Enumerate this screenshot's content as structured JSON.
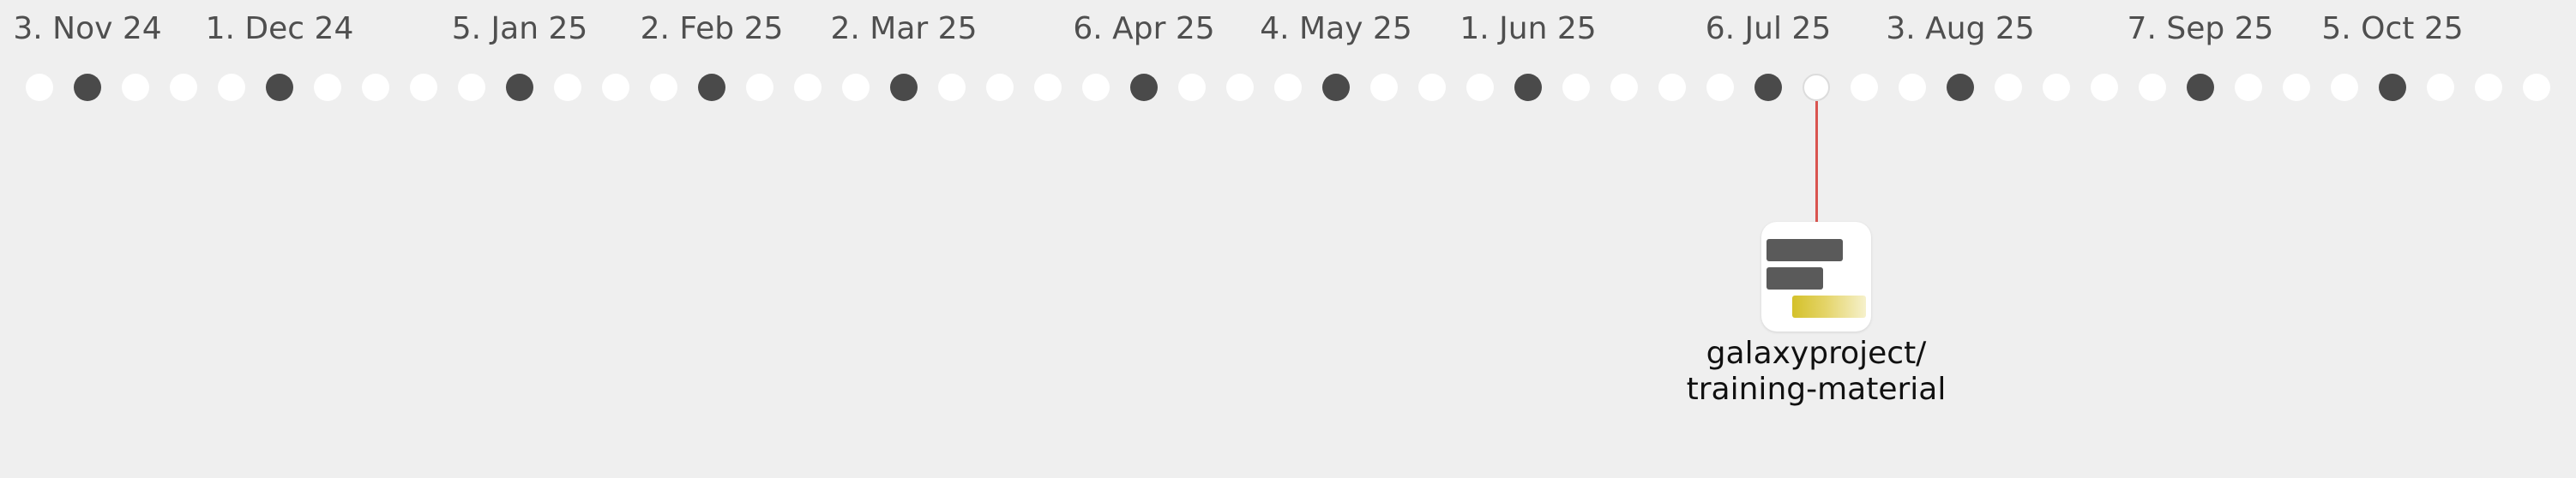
{
  "timeline": {
    "month_labels": [
      "3. Nov 24",
      "1. Dec 24",
      "5. Jan 25",
      "2. Feb 25",
      "2. Mar 25",
      "6. Apr 25",
      "4. May 25",
      "1. Jun 25",
      "6. Jul 25",
      "3. Aug 25",
      "7. Sep 25",
      "5. Oct 25"
    ],
    "dot_count": 53,
    "major_dot_indices": [
      1,
      5,
      10,
      14,
      18,
      23,
      27,
      31,
      36,
      40,
      45,
      49
    ],
    "focused_dot_index": 37,
    "colors": {
      "background": "#efefef",
      "dot": "#ffffff",
      "major_dot": "#4a4a4a",
      "connector": "#d9544f",
      "label": "#4f4f4f"
    }
  },
  "repo": {
    "name_line1": "galaxyproject/",
    "name_line2": "training-material",
    "icon": "repo-bars-icon",
    "accent_color": "#d4c12a"
  }
}
